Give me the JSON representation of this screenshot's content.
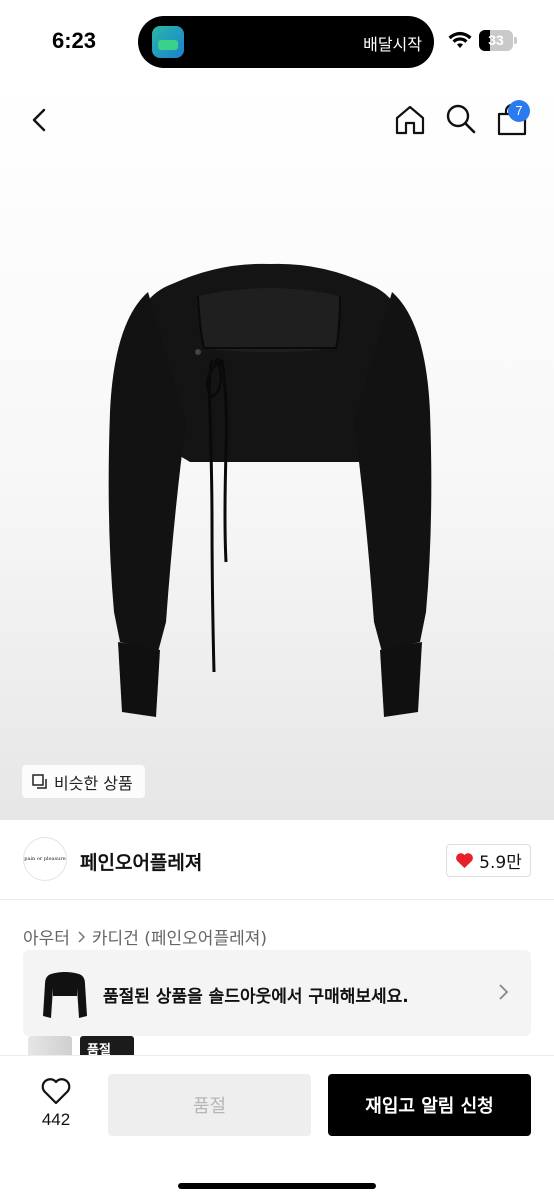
{
  "status_bar": {
    "time": "6:23",
    "live_activity_text": "배달시작",
    "battery": "33",
    "battery_fraction": 0.33
  },
  "nav": {
    "cart_count": "7",
    "icons": [
      "back-icon",
      "home-icon",
      "search-icon",
      "cart-icon"
    ]
  },
  "product": {
    "similar_label": "비슷한 상품"
  },
  "seller": {
    "name": "페인오어플레져",
    "logo_text": "pain or pleasure",
    "likes": "5.9만"
  },
  "category": {
    "parent": "아우터",
    "child": "카디건 (페인오어플레져)"
  },
  "soldout_banner": {
    "text": "품절된 상품을 솔드아웃에서 구매해보세요."
  },
  "peek": {
    "label": "품절"
  },
  "bottom_bar": {
    "wish_count": "442",
    "soldout_label": "품절",
    "restock_label": "재입고 알림 신청"
  },
  "colors": {
    "accent_badge": "#2b7bf0",
    "heart": "#e8202a",
    "primary_button": "#000000",
    "disabled_button": "#eeeeee"
  }
}
